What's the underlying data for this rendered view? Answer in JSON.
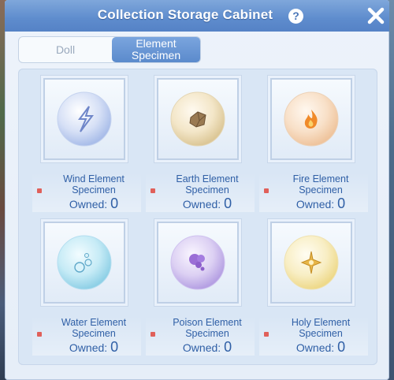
{
  "window": {
    "title": "Collection Storage Cabinet"
  },
  "tabs": [
    {
      "label": "Doll",
      "active": false
    },
    {
      "label": "Element\nSpecimen",
      "active": true
    }
  ],
  "specimens": [
    {
      "name": "Wind Element Specimen",
      "owned_label": "Owned:",
      "owned": "0",
      "icon": "lightning-icon",
      "color": "#c9d6f2"
    },
    {
      "name": "Earth Element Specimen",
      "owned_label": "Owned:",
      "owned": "0",
      "icon": "rock-icon",
      "color": "#f1e3c3"
    },
    {
      "name": "Fire Element Specimen",
      "owned_label": "Owned:",
      "owned": "0",
      "icon": "flame-icon",
      "color": "#f7dcc2"
    },
    {
      "name": "Water Element Specimen",
      "owned_label": "Owned:",
      "owned": "0",
      "icon": "water-drop-icon",
      "color": "#bfe6f3"
    },
    {
      "name": "Poison Element Specimen",
      "owned_label": "Owned:",
      "owned": "0",
      "icon": "poison-cloud-icon",
      "color": "#d4c8ef"
    },
    {
      "name": "Holy Element Specimen",
      "owned_label": "Owned:",
      "owned": "0",
      "icon": "holy-cross-icon",
      "color": "#f6ebbd"
    }
  ],
  "colors": {
    "titlebar": "#5e8ccd",
    "active_tab": "#6a98d5",
    "label_text": "#2f5fa6",
    "indicator": "#e0605a"
  }
}
